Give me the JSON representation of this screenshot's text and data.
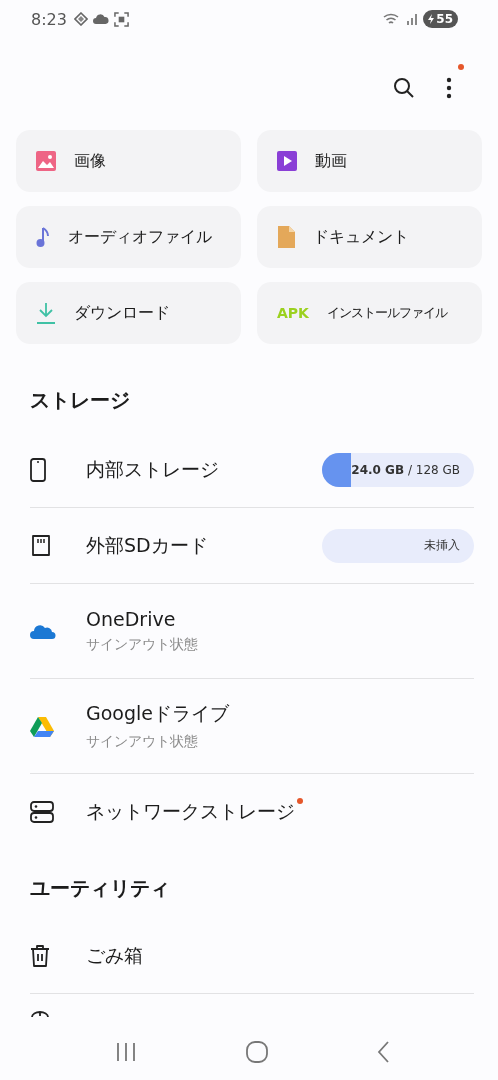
{
  "status_bar": {
    "time": "8:23",
    "battery": "55"
  },
  "toolbar": {
    "menu_badge": true
  },
  "categories": [
    {
      "label": "画像"
    },
    {
      "label": "動画"
    },
    {
      "label": "オーディオファイル"
    },
    {
      "label": "ドキュメント"
    },
    {
      "label": "ダウンロード"
    },
    {
      "label": "インストールファイル",
      "icon_text": "APK"
    }
  ],
  "storage": {
    "title": "ストレージ",
    "items": [
      {
        "label": "内部ストレージ",
        "kind": "usage",
        "level": 0.1875,
        "usage": "**24.0 GB** / 128 GB"
      },
      {
        "label": "外部SDカード",
        "kind": "badge",
        "badge": "未挿入"
      },
      {
        "label": "OneDrive",
        "kind": "account",
        "subtitle": "サインアウト状態"
      },
      {
        "label": "Googleドライブ",
        "kind": "account",
        "subtitle": "サインアウト状態"
      },
      {
        "label": "ネットワークストレージ",
        "kind": "plain",
        "new": true
      }
    ]
  },
  "utilities": {
    "title": "ユーティリティ",
    "items": [
      {
        "label": "ごみ箱"
      }
    ]
  }
}
